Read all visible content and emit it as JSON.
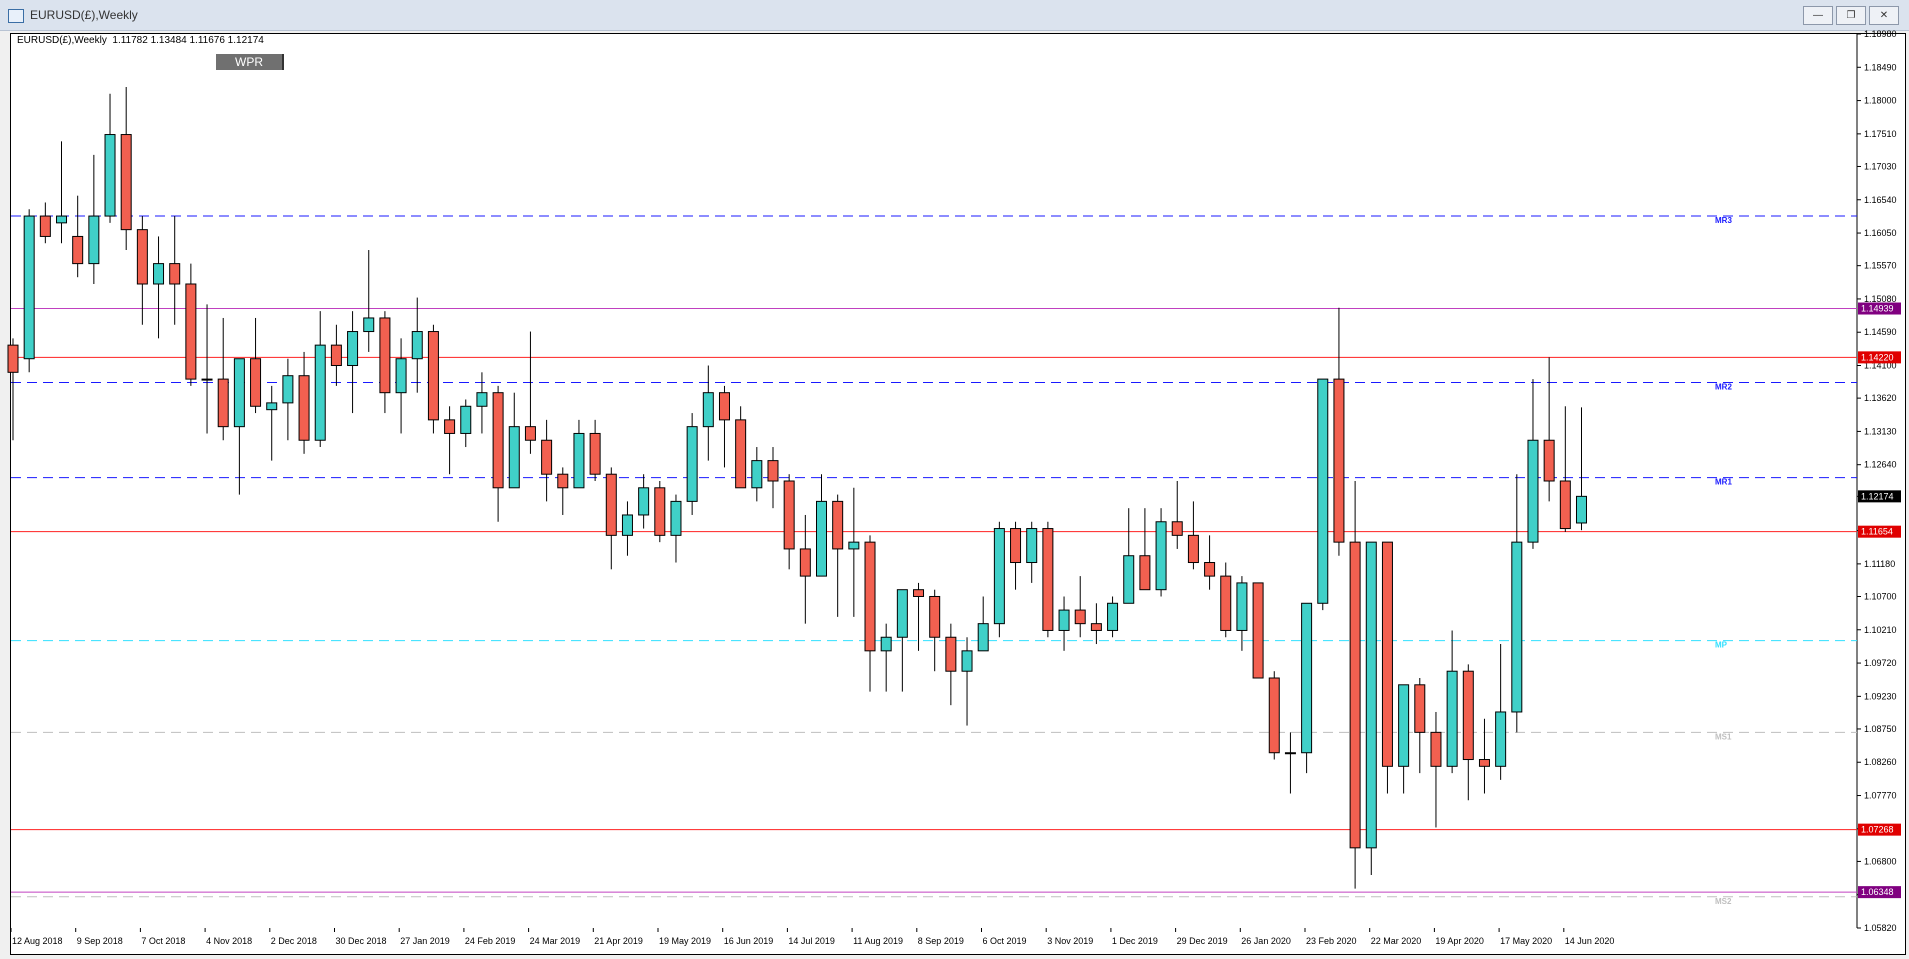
{
  "window": {
    "title": "EURUSD(£),Weekly",
    "buttons": [
      "minimize",
      "restore",
      "close"
    ]
  },
  "chart_info": {
    "header": "EURUSD(£),Weekly  1.11782 1.13484 1.11676 1.12174"
  },
  "indicator_button": {
    "label": "WPR"
  },
  "colors": {
    "bull": "#40d0c8",
    "bear": "#f26050",
    "outline": "#000000",
    "pivot_blue": "#1a1aff",
    "pivot_cyan": "#30e0ff",
    "pivot_gray": "#bfbfbf",
    "purple": "#c040c0",
    "red": "#ff2020"
  },
  "chart_data": {
    "type": "candlestick",
    "symbol": "EURUSD",
    "timeframe": "Weekly",
    "y_range": [
      1.0582,
      1.1898
    ],
    "y_ticks": [
      "1.18980",
      "1.18490",
      "1.18000",
      "1.17510",
      "1.17030",
      "1.16540",
      "1.16050",
      "1.15570",
      "1.15080",
      "1.14590",
      "1.14100",
      "1.13620",
      "1.13130",
      "1.12640",
      "1.12174",
      "1.11670",
      "1.11180",
      "1.10700",
      "1.10210",
      "1.09720",
      "1.09230",
      "1.08750",
      "1.08260",
      "1.07770",
      "1.07280",
      "1.06800",
      "1.06310",
      "1.05820"
    ],
    "x_labels": [
      "12 Aug 2018",
      "9 Sep 2018",
      "7 Oct 2018",
      "4 Nov 2018",
      "2 Dec 2018",
      "30 Dec 2018",
      "27 Jan 2019",
      "24 Feb 2019",
      "24 Mar 2019",
      "21 Apr 2019",
      "19 May 2019",
      "16 Jun 2019",
      "14 Jul 2019",
      "11 Aug 2019",
      "8 Sep 2019",
      "6 Oct 2019",
      "3 Nov 2019",
      "1 Dec 2019",
      "29 Dec 2019",
      "26 Jan 2020",
      "23 Feb 2020",
      "22 Mar 2020",
      "19 Apr 2020",
      "17 May 2020",
      "14 Jun 2020"
    ],
    "candles": [
      [
        1.144,
        1.145,
        1.13,
        1.14
      ],
      [
        1.142,
        1.164,
        1.14,
        1.163
      ],
      [
        1.163,
        1.165,
        1.159,
        1.16
      ],
      [
        1.162,
        1.174,
        1.159,
        1.163
      ],
      [
        1.16,
        1.166,
        1.154,
        1.156
      ],
      [
        1.156,
        1.172,
        1.153,
        1.163
      ],
      [
        1.163,
        1.181,
        1.162,
        1.175
      ],
      [
        1.175,
        1.182,
        1.158,
        1.161
      ],
      [
        1.161,
        1.163,
        1.147,
        1.153
      ],
      [
        1.153,
        1.16,
        1.145,
        1.156
      ],
      [
        1.156,
        1.163,
        1.147,
        1.153
      ],
      [
        1.153,
        1.156,
        1.138,
        1.139
      ],
      [
        1.139,
        1.15,
        1.131,
        1.139
      ],
      [
        1.139,
        1.148,
        1.13,
        1.132
      ],
      [
        1.132,
        1.142,
        1.122,
        1.142
      ],
      [
        1.142,
        1.148,
        1.134,
        1.135
      ],
      [
        1.1345,
        1.138,
        1.127,
        1.1355
      ],
      [
        1.1355,
        1.142,
        1.13,
        1.1395
      ],
      [
        1.1395,
        1.143,
        1.128,
        1.13
      ],
      [
        1.13,
        1.149,
        1.129,
        1.144
      ],
      [
        1.144,
        1.147,
        1.138,
        1.141
      ],
      [
        1.141,
        1.149,
        1.134,
        1.146
      ],
      [
        1.146,
        1.158,
        1.143,
        1.148
      ],
      [
        1.148,
        1.149,
        1.134,
        1.137
      ],
      [
        1.137,
        1.145,
        1.131,
        1.142
      ],
      [
        1.142,
        1.151,
        1.137,
        1.146
      ],
      [
        1.146,
        1.147,
        1.131,
        1.133
      ],
      [
        1.133,
        1.135,
        1.125,
        1.131
      ],
      [
        1.131,
        1.136,
        1.129,
        1.135
      ],
      [
        1.135,
        1.14,
        1.131,
        1.137
      ],
      [
        1.137,
        1.138,
        1.118,
        1.123
      ],
      [
        1.123,
        1.137,
        1.123,
        1.132
      ],
      [
        1.132,
        1.146,
        1.128,
        1.13
      ],
      [
        1.13,
        1.133,
        1.121,
        1.125
      ],
      [
        1.125,
        1.126,
        1.119,
        1.123
      ],
      [
        1.123,
        1.133,
        1.123,
        1.131
      ],
      [
        1.131,
        1.133,
        1.124,
        1.125
      ],
      [
        1.125,
        1.126,
        1.111,
        1.116
      ],
      [
        1.116,
        1.121,
        1.113,
        1.119
      ],
      [
        1.119,
        1.125,
        1.117,
        1.123
      ],
      [
        1.123,
        1.124,
        1.115,
        1.116
      ],
      [
        1.116,
        1.122,
        1.112,
        1.121
      ],
      [
        1.121,
        1.134,
        1.119,
        1.132
      ],
      [
        1.132,
        1.141,
        1.127,
        1.137
      ],
      [
        1.137,
        1.138,
        1.126,
        1.133
      ],
      [
        1.133,
        1.135,
        1.123,
        1.123
      ],
      [
        1.123,
        1.129,
        1.121,
        1.127
      ],
      [
        1.127,
        1.129,
        1.12,
        1.124
      ],
      [
        1.124,
        1.125,
        1.111,
        1.114
      ],
      [
        1.114,
        1.119,
        1.103,
        1.11
      ],
      [
        1.11,
        1.125,
        1.11,
        1.121
      ],
      [
        1.121,
        1.122,
        1.104,
        1.114
      ],
      [
        1.114,
        1.123,
        1.104,
        1.115
      ],
      [
        1.115,
        1.116,
        1.093,
        1.099
      ],
      [
        1.099,
        1.103,
        1.093,
        1.101
      ],
      [
        1.101,
        1.108,
        1.093,
        1.108
      ],
      [
        1.108,
        1.109,
        1.099,
        1.107
      ],
      [
        1.107,
        1.108,
        1.096,
        1.101
      ],
      [
        1.101,
        1.103,
        1.091,
        1.096
      ],
      [
        1.096,
        1.101,
        1.088,
        1.099
      ],
      [
        1.099,
        1.107,
        1.099,
        1.103
      ],
      [
        1.103,
        1.118,
        1.101,
        1.117
      ],
      [
        1.117,
        1.118,
        1.108,
        1.112
      ],
      [
        1.112,
        1.118,
        1.109,
        1.117
      ],
      [
        1.117,
        1.118,
        1.101,
        1.102
      ],
      [
        1.102,
        1.107,
        1.099,
        1.105
      ],
      [
        1.105,
        1.11,
        1.101,
        1.103
      ],
      [
        1.103,
        1.106,
        1.1,
        1.102
      ],
      [
        1.102,
        1.107,
        1.101,
        1.106
      ],
      [
        1.106,
        1.12,
        1.106,
        1.113
      ],
      [
        1.113,
        1.12,
        1.108,
        1.108
      ],
      [
        1.108,
        1.12,
        1.107,
        1.118
      ],
      [
        1.118,
        1.124,
        1.114,
        1.116
      ],
      [
        1.116,
        1.121,
        1.111,
        1.112
      ],
      [
        1.112,
        1.116,
        1.108,
        1.11
      ],
      [
        1.11,
        1.112,
        1.101,
        1.102
      ],
      [
        1.102,
        1.11,
        1.099,
        1.109
      ],
      [
        1.109,
        1.109,
        1.095,
        1.095
      ],
      [
        1.095,
        1.096,
        1.083,
        1.084
      ],
      [
        1.084,
        1.087,
        1.078,
        1.084
      ],
      [
        1.084,
        1.106,
        1.081,
        1.106
      ],
      [
        1.106,
        1.139,
        1.105,
        1.139
      ],
      [
        1.139,
        1.1495,
        1.113,
        1.115
      ],
      [
        1.115,
        1.124,
        1.064,
        1.07
      ],
      [
        1.07,
        1.115,
        1.066,
        1.115
      ],
      [
        1.115,
        1.115,
        1.078,
        1.082
      ],
      [
        1.082,
        1.094,
        1.078,
        1.094
      ],
      [
        1.094,
        1.095,
        1.081,
        1.087
      ],
      [
        1.087,
        1.09,
        1.073,
        1.082
      ],
      [
        1.082,
        1.102,
        1.081,
        1.096
      ],
      [
        1.096,
        1.097,
        1.077,
        1.083
      ],
      [
        1.083,
        1.089,
        1.078,
        1.082
      ],
      [
        1.082,
        1.1,
        1.08,
        1.09
      ],
      [
        1.09,
        1.125,
        1.087,
        1.115
      ],
      [
        1.115,
        1.139,
        1.114,
        1.13
      ],
      [
        1.13,
        1.1422,
        1.121,
        1.124
      ],
      [
        1.124,
        1.135,
        1.1165,
        1.117
      ],
      [
        1.11782,
        1.13484,
        1.11676,
        1.12174
      ]
    ],
    "pivots": [
      {
        "label": "MR3",
        "value": 1.163,
        "color": "#1a1aff"
      },
      {
        "label": "MR2",
        "value": 1.1385,
        "color": "#1a1aff"
      },
      {
        "label": "MR1",
        "value": 1.1245,
        "color": "#1a1aff"
      },
      {
        "label": "MP",
        "value": 1.1005,
        "color": "#30e0ff"
      },
      {
        "label": "MS1",
        "value": 1.087,
        "color": "#bfbfbf"
      },
      {
        "label": "MS2",
        "value": 1.0628,
        "color": "#bfbfbf"
      }
    ],
    "price_lines": [
      {
        "label": "1.14939",
        "value": 1.14939,
        "color": "#c040c0",
        "tagbg": "#800080"
      },
      {
        "label": "1.14220",
        "value": 1.1422,
        "color": "#ff2020",
        "tagbg": "#e00000"
      },
      {
        "label": "1.12174",
        "value": 1.12174,
        "color": null,
        "tagbg": "#000000"
      },
      {
        "label": "1.11654",
        "value": 1.11654,
        "color": "#ff2020",
        "tagbg": "#e00000"
      },
      {
        "label": "1.07268",
        "value": 1.07268,
        "color": "#ff2020",
        "tagbg": "#e00000"
      },
      {
        "label": "1.06348",
        "value": 1.06348,
        "color": "#c040c0",
        "tagbg": "#800080"
      }
    ]
  }
}
